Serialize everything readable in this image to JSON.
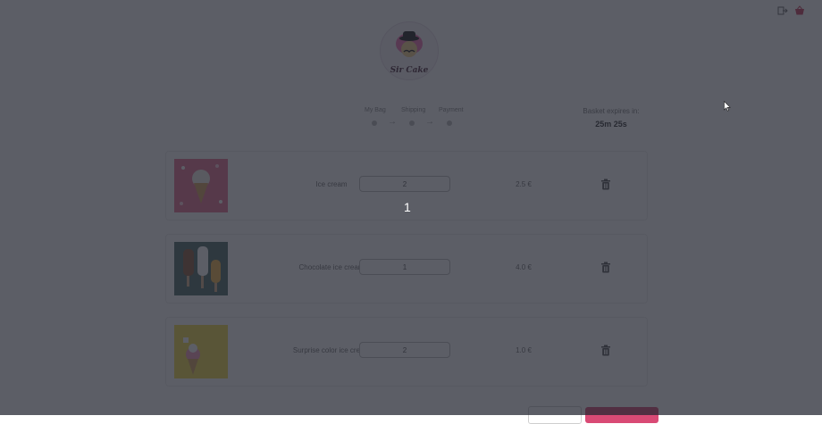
{
  "header": {
    "logout_icon": "logout-icon",
    "basket_icon": "basket-icon"
  },
  "logo": {
    "text": "Sir Cake"
  },
  "checkout_steps": [
    {
      "label": "My Bag"
    },
    {
      "label": "Shipping"
    },
    {
      "label": "Payment"
    }
  ],
  "basket_expiry": {
    "label": "Basket expires in:",
    "time": "25m 25s"
  },
  "cart_items": [
    {
      "name": "Ice cream",
      "quantity": "2",
      "price": "2.5 €"
    },
    {
      "name": "Chocolate ice cream",
      "quantity": "1",
      "price": "4.0 €"
    },
    {
      "name": "Surprise color ice cream",
      "quantity": "2",
      "price": "1.0 €"
    }
  ],
  "quantity_hint": "1",
  "colors": {
    "accent": "#d94a75",
    "overlay": "#232630"
  }
}
